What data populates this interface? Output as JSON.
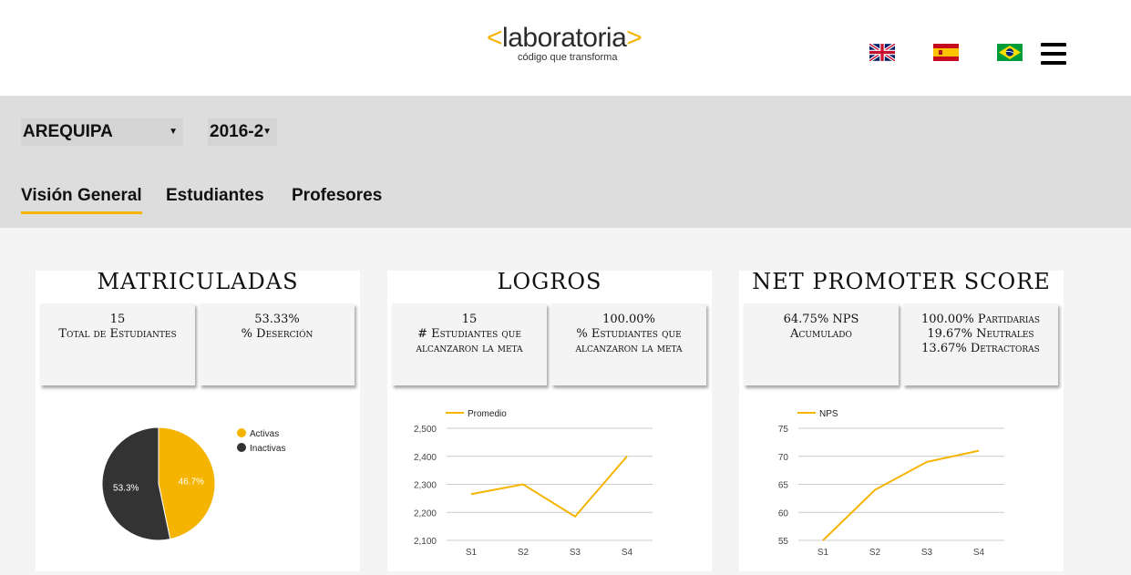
{
  "header": {
    "logo": {
      "open_bracket": "<",
      "name": "laboratoria",
      "close_bracket": ">",
      "tagline": "código que transforma"
    },
    "languages": [
      "english-flag",
      "spanish-flag",
      "brazil-flag"
    ],
    "menu_icon": "hamburger-menu-icon"
  },
  "filters": {
    "city": "AREQUIPA",
    "term": "2016-2"
  },
  "tabs": [
    "Visión General",
    "Estudiantes",
    "Profesores"
  ],
  "active_tab": "Visión General",
  "colors": {
    "accent": "#f4b400",
    "dark": "#333333",
    "band": "#dddddd"
  },
  "cards": {
    "matriculadas": {
      "title": "MATRICULADAS",
      "stat_left": [
        "15",
        "Total de Estudiantes"
      ],
      "stat_right": [
        "53.33%",
        "% Deserción"
      ]
    },
    "logros": {
      "title": "LOGROS",
      "stat_left": [
        "15",
        "# Estudiantes que",
        "alcanzaron la meta"
      ],
      "stat_right": [
        "100.00%",
        "% Estudiantes que",
        "alcanzaron la meta"
      ]
    },
    "nps": {
      "title": "NET PROMOTER SCORE",
      "stat_left": [
        "64.75% NPS",
        "Acumulado"
      ],
      "stat_right": [
        "100.00% Partidarias",
        "19.67% Neutrales",
        "13.67% Detractoras"
      ]
    }
  },
  "chart_data": [
    {
      "type": "pie",
      "labels": [
        "Activas",
        "Inactivas"
      ],
      "values": [
        46.7,
        53.3
      ],
      "value_labels": [
        "46.7%",
        "53.3%"
      ],
      "colors": [
        "#f4b400",
        "#333333"
      ],
      "legend": "top-right"
    },
    {
      "type": "line",
      "categories": [
        "S1",
        "S2",
        "S3",
        "S4"
      ],
      "series": [
        {
          "name": "Promedio",
          "values": [
            2265,
            2300,
            2185,
            2400
          ]
        }
      ],
      "yticks": [
        "2,100",
        "2,200",
        "2,300",
        "2,400",
        "2,500"
      ],
      "ylim": [
        2100,
        2500
      ],
      "grid": true,
      "legend": "top-left"
    },
    {
      "type": "line",
      "categories": [
        "S1",
        "S2",
        "S3",
        "S4"
      ],
      "series": [
        {
          "name": "NPS",
          "values": [
            55,
            64,
            69,
            71
          ]
        }
      ],
      "yticks": [
        "55",
        "60",
        "65",
        "70",
        "75"
      ],
      "ylim": [
        55,
        75
      ],
      "grid": true,
      "legend": "top-left"
    }
  ]
}
